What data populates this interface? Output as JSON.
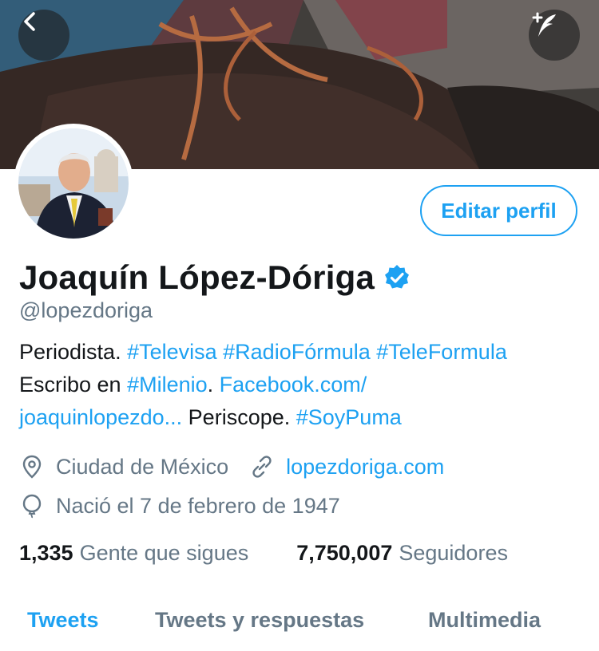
{
  "header": {
    "back_icon": "chevron-left-icon",
    "compose_icon": "plus-feather-icon"
  },
  "profile": {
    "name": "Joaquín López-Dóriga",
    "handle": "@lopezdoriga",
    "verified": true,
    "edit_button": "Editar perfil",
    "bio": {
      "line1": {
        "text1": "Periodista. ",
        "tag1": "#Televisa",
        "sp1": " ",
        "tag2": "#RadioFórmula",
        "sp2": " ",
        "tag3": "#TeleFormula"
      },
      "line2": {
        "text1": "Escribo en ",
        "tag1": "#Milenio",
        "text2": ". ",
        "link1": "Facebook.com/"
      },
      "line3": {
        "link1": "joaquinlopezdo...",
        "text1": " Periscope. ",
        "tag1": "#SoyPuma"
      }
    },
    "location": "Ciudad de México",
    "website": "lopezdoriga.com",
    "birthday": "Nació el 7 de febrero de 1947",
    "following_count": "1,335",
    "following_label": "Gente que sigues",
    "followers_count": "7,750,007",
    "followers_label": "Seguidores"
  },
  "tabs": [
    {
      "label": "Tweets",
      "active": true
    },
    {
      "label": "Tweets y respuestas",
      "active": false
    },
    {
      "label": "Multimedia",
      "active": false
    }
  ],
  "colors": {
    "accent": "#1da1f2",
    "secondary_text": "#657786",
    "primary_text": "#14171a"
  }
}
